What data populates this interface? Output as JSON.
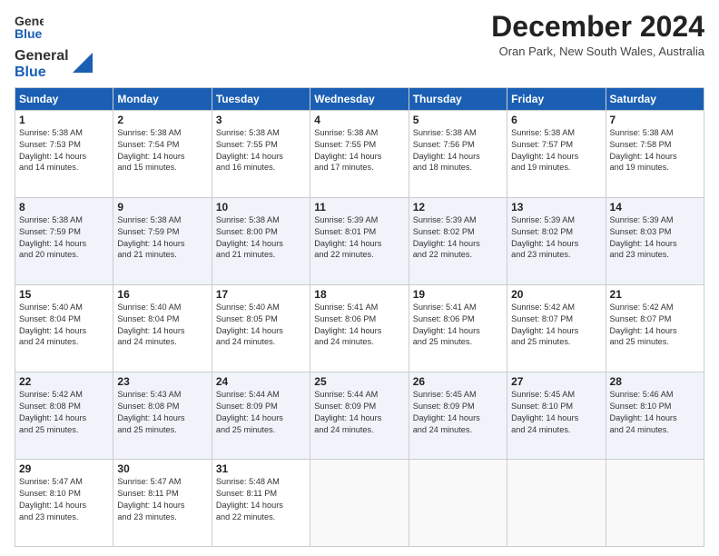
{
  "logo": {
    "line1": "General",
    "line2": "Blue"
  },
  "title": "December 2024",
  "subtitle": "Oran Park, New South Wales, Australia",
  "days_header": [
    "Sunday",
    "Monday",
    "Tuesday",
    "Wednesday",
    "Thursday",
    "Friday",
    "Saturday"
  ],
  "weeks": [
    [
      {
        "day": "1",
        "info": "Sunrise: 5:38 AM\nSunset: 7:53 PM\nDaylight: 14 hours\nand 14 minutes."
      },
      {
        "day": "2",
        "info": "Sunrise: 5:38 AM\nSunset: 7:54 PM\nDaylight: 14 hours\nand 15 minutes."
      },
      {
        "day": "3",
        "info": "Sunrise: 5:38 AM\nSunset: 7:55 PM\nDaylight: 14 hours\nand 16 minutes."
      },
      {
        "day": "4",
        "info": "Sunrise: 5:38 AM\nSunset: 7:55 PM\nDaylight: 14 hours\nand 17 minutes."
      },
      {
        "day": "5",
        "info": "Sunrise: 5:38 AM\nSunset: 7:56 PM\nDaylight: 14 hours\nand 18 minutes."
      },
      {
        "day": "6",
        "info": "Sunrise: 5:38 AM\nSunset: 7:57 PM\nDaylight: 14 hours\nand 19 minutes."
      },
      {
        "day": "7",
        "info": "Sunrise: 5:38 AM\nSunset: 7:58 PM\nDaylight: 14 hours\nand 19 minutes."
      }
    ],
    [
      {
        "day": "8",
        "info": "Sunrise: 5:38 AM\nSunset: 7:59 PM\nDaylight: 14 hours\nand 20 minutes."
      },
      {
        "day": "9",
        "info": "Sunrise: 5:38 AM\nSunset: 7:59 PM\nDaylight: 14 hours\nand 21 minutes."
      },
      {
        "day": "10",
        "info": "Sunrise: 5:38 AM\nSunset: 8:00 PM\nDaylight: 14 hours\nand 21 minutes."
      },
      {
        "day": "11",
        "info": "Sunrise: 5:39 AM\nSunset: 8:01 PM\nDaylight: 14 hours\nand 22 minutes."
      },
      {
        "day": "12",
        "info": "Sunrise: 5:39 AM\nSunset: 8:02 PM\nDaylight: 14 hours\nand 22 minutes."
      },
      {
        "day": "13",
        "info": "Sunrise: 5:39 AM\nSunset: 8:02 PM\nDaylight: 14 hours\nand 23 minutes."
      },
      {
        "day": "14",
        "info": "Sunrise: 5:39 AM\nSunset: 8:03 PM\nDaylight: 14 hours\nand 23 minutes."
      }
    ],
    [
      {
        "day": "15",
        "info": "Sunrise: 5:40 AM\nSunset: 8:04 PM\nDaylight: 14 hours\nand 24 minutes."
      },
      {
        "day": "16",
        "info": "Sunrise: 5:40 AM\nSunset: 8:04 PM\nDaylight: 14 hours\nand 24 minutes."
      },
      {
        "day": "17",
        "info": "Sunrise: 5:40 AM\nSunset: 8:05 PM\nDaylight: 14 hours\nand 24 minutes."
      },
      {
        "day": "18",
        "info": "Sunrise: 5:41 AM\nSunset: 8:06 PM\nDaylight: 14 hours\nand 24 minutes."
      },
      {
        "day": "19",
        "info": "Sunrise: 5:41 AM\nSunset: 8:06 PM\nDaylight: 14 hours\nand 25 minutes."
      },
      {
        "day": "20",
        "info": "Sunrise: 5:42 AM\nSunset: 8:07 PM\nDaylight: 14 hours\nand 25 minutes."
      },
      {
        "day": "21",
        "info": "Sunrise: 5:42 AM\nSunset: 8:07 PM\nDaylight: 14 hours\nand 25 minutes."
      }
    ],
    [
      {
        "day": "22",
        "info": "Sunrise: 5:42 AM\nSunset: 8:08 PM\nDaylight: 14 hours\nand 25 minutes."
      },
      {
        "day": "23",
        "info": "Sunrise: 5:43 AM\nSunset: 8:08 PM\nDaylight: 14 hours\nand 25 minutes."
      },
      {
        "day": "24",
        "info": "Sunrise: 5:44 AM\nSunset: 8:09 PM\nDaylight: 14 hours\nand 25 minutes."
      },
      {
        "day": "25",
        "info": "Sunrise: 5:44 AM\nSunset: 8:09 PM\nDaylight: 14 hours\nand 24 minutes."
      },
      {
        "day": "26",
        "info": "Sunrise: 5:45 AM\nSunset: 8:09 PM\nDaylight: 14 hours\nand 24 minutes."
      },
      {
        "day": "27",
        "info": "Sunrise: 5:45 AM\nSunset: 8:10 PM\nDaylight: 14 hours\nand 24 minutes."
      },
      {
        "day": "28",
        "info": "Sunrise: 5:46 AM\nSunset: 8:10 PM\nDaylight: 14 hours\nand 24 minutes."
      }
    ],
    [
      {
        "day": "29",
        "info": "Sunrise: 5:47 AM\nSunset: 8:10 PM\nDaylight: 14 hours\nand 23 minutes."
      },
      {
        "day": "30",
        "info": "Sunrise: 5:47 AM\nSunset: 8:11 PM\nDaylight: 14 hours\nand 23 minutes."
      },
      {
        "day": "31",
        "info": "Sunrise: 5:48 AM\nSunset: 8:11 PM\nDaylight: 14 hours\nand 22 minutes."
      },
      {
        "day": "",
        "info": ""
      },
      {
        "day": "",
        "info": ""
      },
      {
        "day": "",
        "info": ""
      },
      {
        "day": "",
        "info": ""
      }
    ]
  ]
}
